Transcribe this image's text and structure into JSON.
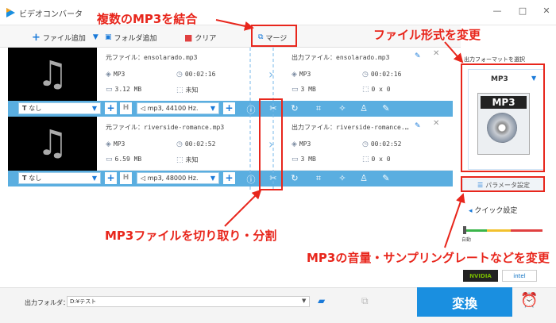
{
  "app": {
    "title": "ビデオコンバータ"
  },
  "toolbar": {
    "add_file": "ファイル追加",
    "add_folder": "フォルダ追加",
    "clear": "クリア",
    "merge": "マージ"
  },
  "files": [
    {
      "source_label": "元ファイル：ensolarado.mp3",
      "output_label": "出力ファイル：ensolarado.mp3",
      "format": "MP3",
      "duration": "00:02:16",
      "size": "3.12 MB",
      "resolution": "未知",
      "out_format": "MP3",
      "out_duration": "00:02:16",
      "out_size": "3 MB",
      "out_resolution": "0 x 0",
      "subtitle": "なし",
      "audio": "mp3, 44100 Hz."
    },
    {
      "source_label": "元ファイル：riverside-romance.mp3",
      "output_label": "出力ファイル：riverside-romance.…",
      "format": "MP3",
      "duration": "00:02:52",
      "size": "6.59 MB",
      "resolution": "未知",
      "out_format": "MP3",
      "out_duration": "00:02:52",
      "out_size": "3 MB",
      "out_resolution": "0 x 0",
      "subtitle": "なし",
      "audio": "mp3, 48000 Hz."
    }
  ],
  "panel": {
    "format_label": "出力フォーマットを選択",
    "format": "MP3",
    "icon_text": "MP3",
    "param_button": "パラメータ設定",
    "quick_label": "クイック設定",
    "slider_label": "自動",
    "slider_level": 0,
    "hw1": "NVIDIA",
    "hw2": "intel"
  },
  "bottom": {
    "output_label": "出力フォルダ：",
    "output_path": "D:¥テスト",
    "convert_button": "変換"
  },
  "annotations": {
    "merge": "複数のMP3を結合",
    "format": "ファイル形式を変更",
    "cut": "MP3ファイルを切り取り・分割",
    "params": "MP3の音量・サンプリングレートなどを変更"
  },
  "colors": {
    "accent": "#1a8fe0",
    "annotation": "#e8261c",
    "bar": "#5aaee0"
  }
}
